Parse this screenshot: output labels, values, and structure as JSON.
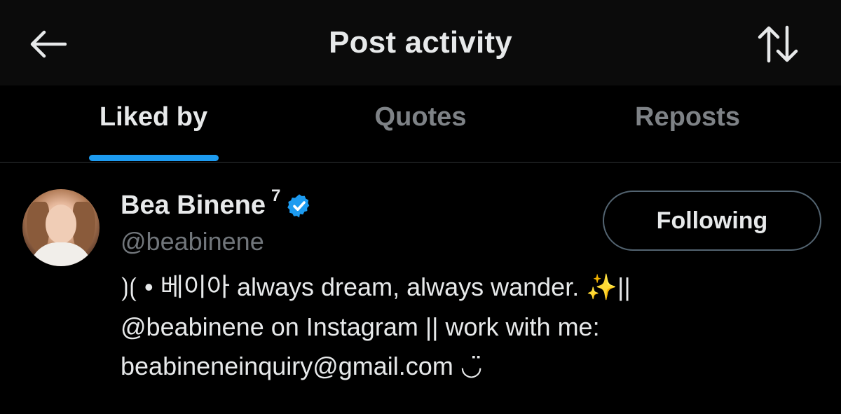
{
  "header": {
    "title": "Post activity",
    "back_icon": "arrow-left-icon",
    "sort_icon": "sort-arrows-icon"
  },
  "tabs": [
    {
      "label": "Liked by",
      "active": true
    },
    {
      "label": "Quotes",
      "active": false
    },
    {
      "label": "Reposts",
      "active": false
    }
  ],
  "colors": {
    "accent": "#1d9bf0",
    "background": "#000000",
    "header_background": "#0b0b0b",
    "muted_text": "#71767b",
    "divider": "#2f3336"
  },
  "user": {
    "name": "Bea Binene",
    "name_suffix": "7",
    "verified": true,
    "handle": "@beabinene",
    "follow_label": "Following",
    "bio": {
      "line1_prefix": "베이아 always dream, always wander.",
      "line1_suffix": "||",
      "line2": "@beabinene on Instagram || work with me:",
      "line3": "beabineneinquiry@gmail.com",
      "symbol": "⟯⟮",
      "bullet": "•",
      "sparkles": "✨",
      "smile": "◡̈"
    }
  }
}
